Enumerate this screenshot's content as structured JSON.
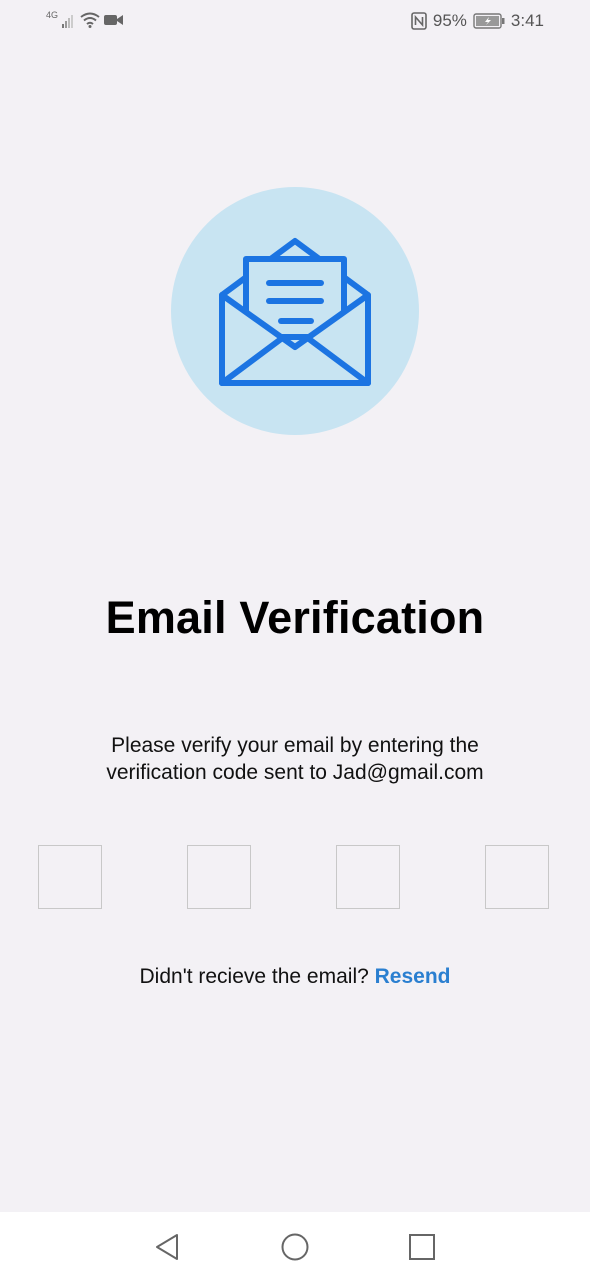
{
  "status_bar": {
    "network_label": "4G",
    "battery_percent": "95%",
    "time": "3:41",
    "icons": [
      "signal-icon",
      "wifi-icon",
      "video-camera-icon",
      "nfc-icon",
      "battery-icon"
    ]
  },
  "hero": {
    "icon": "open-envelope-icon",
    "circle_color": "#c8e4f2",
    "icon_color": "#1c74e2"
  },
  "title": "Email Verification",
  "subtitle": {
    "line1": "Please verify your email by entering the",
    "line2": "verification code sent to Jad@gmail.com"
  },
  "code_inputs": [
    "",
    "",
    "",
    ""
  ],
  "resend": {
    "prompt": "Didn't recieve the email?",
    "link_label": "Resend",
    "link_color": "#2a7fd0"
  },
  "nav_bar": {
    "buttons": [
      "back-triangle-icon",
      "home-circle-icon",
      "recents-square-icon"
    ]
  }
}
